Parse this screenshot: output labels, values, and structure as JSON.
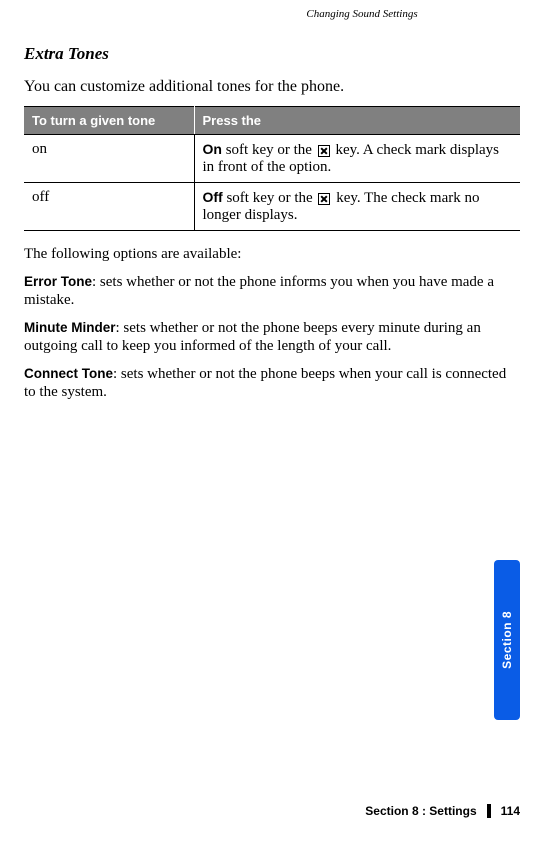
{
  "header": {
    "breadcrumb": "Changing Sound Settings"
  },
  "title": "Extra Tones",
  "intro": "You can customize additional tones for the phone.",
  "table": {
    "headers": {
      "col1": "To turn a given tone",
      "col2": "Press the"
    },
    "rows": [
      {
        "col1": "on",
        "bold": "On",
        "rest1": " soft key or the ",
        "rest2": " key. A check mark displays in front of the option."
      },
      {
        "col1": "off",
        "bold": "Off",
        "rest1": " soft key or the ",
        "rest2": " key. The check mark no longer displays."
      }
    ]
  },
  "options_intro": "The following options are available:",
  "options": [
    {
      "name": "Error Tone",
      "desc": ": sets whether or not the phone informs you when you have made a mistake."
    },
    {
      "name": "Minute Minder",
      "desc": ": sets whether or not the phone beeps every minute during an outgoing call to keep you informed of the length of your call."
    },
    {
      "name": "Connect Tone",
      "desc": ": sets whether or not the phone beeps when your call is connected to the system."
    }
  ],
  "side_tab": "Section 8",
  "footer": {
    "section": "Section 8 : Settings",
    "page": "114"
  }
}
